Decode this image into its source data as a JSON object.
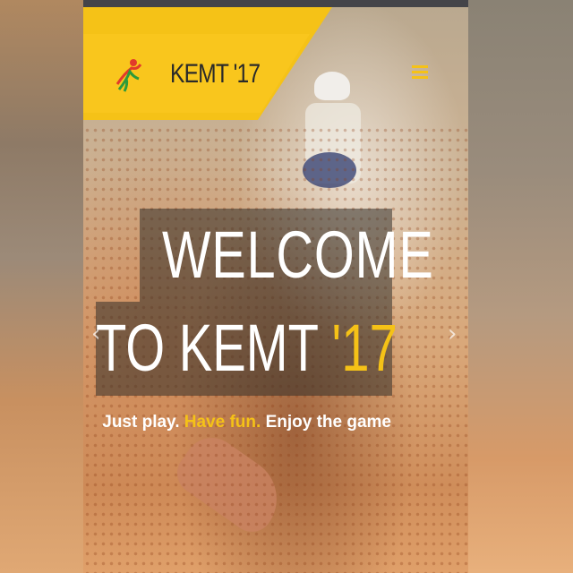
{
  "brand": {
    "name": "KEMT",
    "suffix": "'17"
  },
  "hero": {
    "line1": "WELCOME",
    "line2": "TO KEMT",
    "line2_accent": "'17",
    "tagline_part1": "Just play.",
    "tagline_accent": "Have fun.",
    "tagline_part2": "Enjoy the game"
  },
  "colors": {
    "accent": "#f5c217",
    "overlay": "#322d28",
    "status_bar": "#444449"
  },
  "icons": {
    "menu": "hamburger-icon",
    "prev": "chevron-left-icon",
    "next": "chevron-right-icon"
  }
}
